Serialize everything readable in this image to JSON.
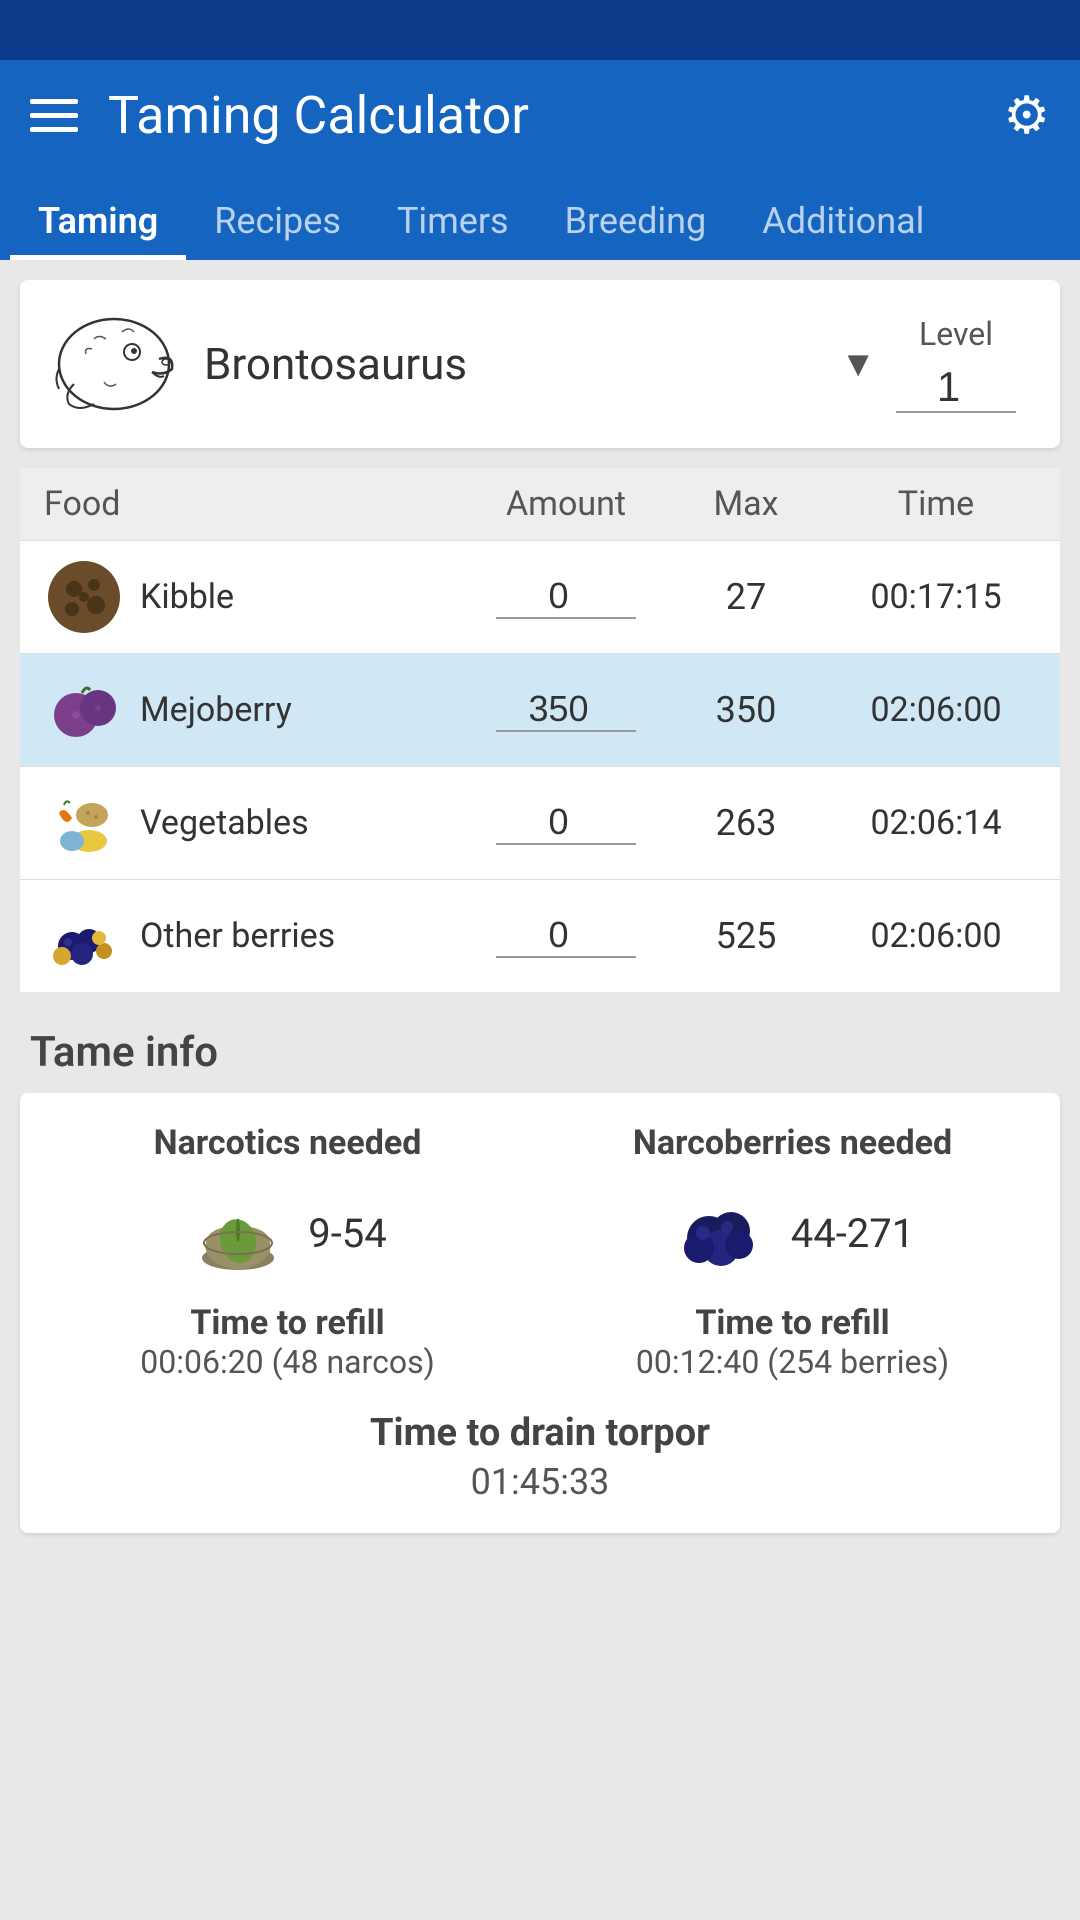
{
  "app": {
    "title": "Taming Calculator"
  },
  "tabs": [
    {
      "label": "Taming",
      "active": true
    },
    {
      "label": "Recipes",
      "active": false
    },
    {
      "label": "Timers",
      "active": false
    },
    {
      "label": "Breeding",
      "active": false
    },
    {
      "label": "Additional",
      "active": false
    }
  ],
  "creature": {
    "name": "Brontosaurus",
    "level_label": "Level",
    "level_value": "1"
  },
  "food_table": {
    "headers": {
      "food": "Food",
      "amount": "Amount",
      "max": "Max",
      "time": "Time"
    },
    "rows": [
      {
        "name": "Kibble",
        "amount": "0",
        "max": "27",
        "time": "00:17:15",
        "highlighted": false
      },
      {
        "name": "Mejoberry",
        "amount": "350",
        "max": "350",
        "time": "02:06:00",
        "highlighted": true
      },
      {
        "name": "Vegetables",
        "amount": "0",
        "max": "263",
        "time": "02:06:14",
        "highlighted": false
      },
      {
        "name": "Other berries",
        "amount": "0",
        "max": "525",
        "time": "02:06:00",
        "highlighted": false
      }
    ]
  },
  "tame_info": {
    "section_title": "Tame info",
    "narcotics": {
      "title": "Narcotics needed",
      "value": "9-54"
    },
    "narcoberries": {
      "title": "Narcoberries needed",
      "value": "44-271"
    },
    "narcotics_refill": {
      "title": "Time to refill",
      "value": "00:06:20 (48 narcos)"
    },
    "narcoberries_refill": {
      "title": "Time to refill",
      "value": "00:12:40 (254 berries)"
    },
    "drain": {
      "title": "Time to drain torpor",
      "value": "01:45:33"
    }
  }
}
